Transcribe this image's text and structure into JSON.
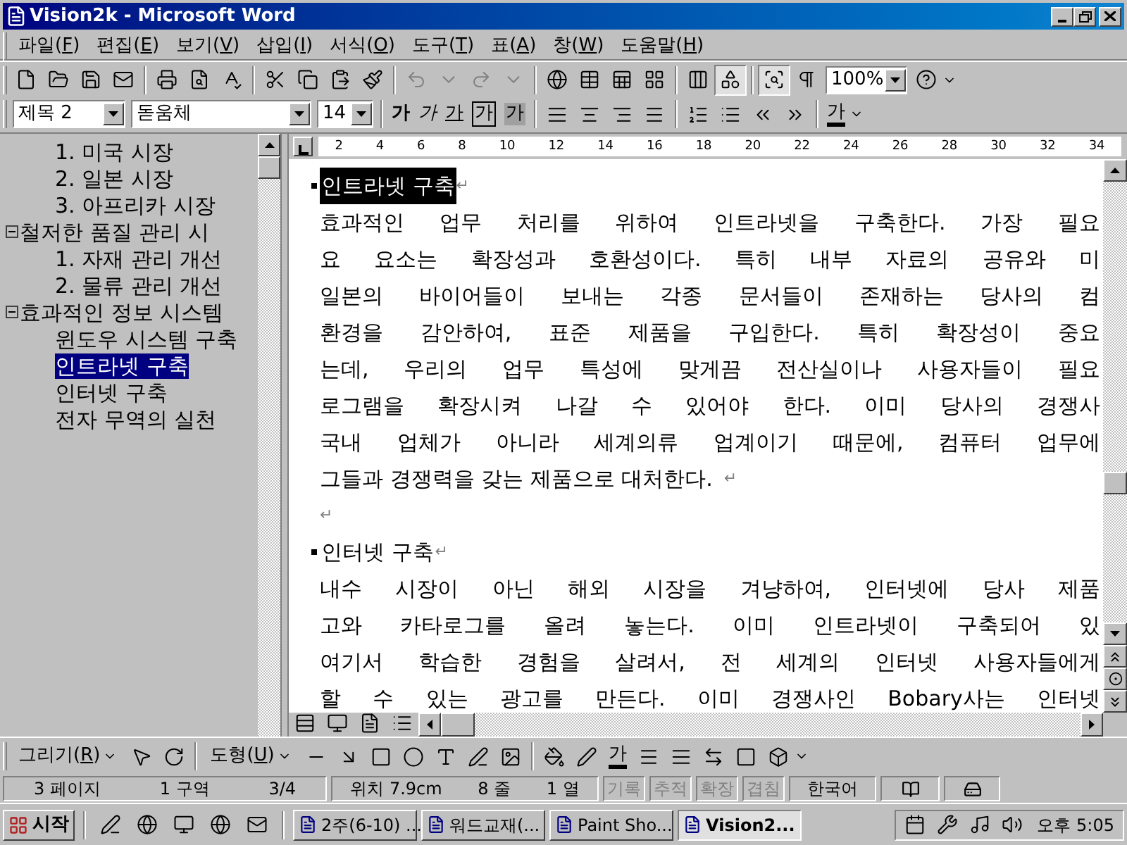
{
  "window": {
    "title": "Vision2k - Microsoft Word"
  },
  "menu": [
    "파일(F)",
    "편집(E)",
    "보기(V)",
    "삽입(I)",
    "서식(O)",
    "도구(T)",
    "표(A)",
    "창(W)",
    "도움말(H)"
  ],
  "standard_toolbar": {
    "drawing_pressed": true,
    "document_map_pressed": true,
    "zoom": "100%"
  },
  "formatting_toolbar": {
    "style": "제목 2",
    "font": "돋움체",
    "size": "14",
    "char_buttons": [
      {
        "kind": "bold",
        "label": "가"
      },
      {
        "kind": "italic",
        "label": "가"
      },
      {
        "kind": "underline",
        "label": "가"
      },
      {
        "kind": "border",
        "label": "가"
      },
      {
        "kind": "shading",
        "label": "가"
      }
    ],
    "font_color": "가"
  },
  "document_map": {
    "continued_children": [
      {
        "text": "1. 미국 시장",
        "selected": false
      },
      {
        "text": "2. 일본 시장",
        "selected": false
      },
      {
        "text": "3. 아프리카 시장",
        "selected": false
      }
    ],
    "items": [
      {
        "text": "철저한 품질 관리 시",
        "expanded": true,
        "children": [
          {
            "text": "1. 자재 관리 개선",
            "selected": false
          },
          {
            "text": "2. 물류 관리 개선",
            "selected": false
          }
        ]
      },
      {
        "text": "효과적인 정보 시스템",
        "expanded": true,
        "children": [
          {
            "text": "윈도우 시스템 구축",
            "selected": false
          },
          {
            "text": "인트라넷 구축",
            "selected": true
          },
          {
            "text": "인터넷 구축",
            "selected": false
          },
          {
            "text": "전자 무역의 실천",
            "selected": false
          }
        ]
      }
    ]
  },
  "ruler": {
    "labels": [
      "2",
      "4",
      "6",
      "8",
      "10",
      "12",
      "14",
      "16",
      "18",
      "20",
      "22",
      "24",
      "26",
      "28",
      "30",
      "32",
      "34"
    ]
  },
  "document": {
    "blocks": [
      {
        "kind": "heading",
        "text": "인트라넷 구축",
        "selected": true,
        "mark": "↵"
      },
      {
        "kind": "body",
        "lines": [
          "효과적인 업무 처리를 위하여 인트라넷을 구축한다. 가장 필요",
          "요 요소는 확장성과 호환성이다. 특히 내부 자료의 공유와 미",
          "일본의 바이어들이 보내는 각종 문서들이 존재하는 당사의 컴",
          "환경을 감안하여, 표준 제품을 구입한다. 특히 확장성이 중요",
          "는데, 우리의 업무 특성에 맞게끔 전산실이나 사용자들이 필요",
          "로그램을 확장시켜 나갈 수 있어야 한다. 이미 당사의 경쟁사",
          "국내 업체가 아니라 세계의류 업계이기 때문에, 컴퓨터 업무에",
          "그들과 경쟁력을 갖는 제품으로 대처한다."
        ],
        "mark": "↵"
      },
      {
        "kind": "empty",
        "mark": "↵"
      },
      {
        "kind": "heading",
        "text": "인터넷 구축",
        "selected": false,
        "mark": "↵"
      },
      {
        "kind": "body",
        "lines": [
          "내수 시장이 아닌 해외 시장을 겨냥하여, 인터넷에 당사 제품",
          "고와 카타로그를 올려 놓는다. 이미 인트라넷이 구축되어 있",
          "여기서 학습한 경험을 살려서, 전 세계의 인터넷 사용자들에게",
          "할 수 있는 광고를 만든다. 이미 경쟁사인 Bobary사는 인터넷"
        ]
      }
    ]
  },
  "drawing_toolbar": {
    "draw_menu": "그리기(R)",
    "autoshapes_menu": "도형(U)",
    "font_color": "가"
  },
  "status_bar": {
    "panels": [
      [
        "3 페이지",
        "1 구역",
        "3/4"
      ],
      [
        "위치 7.9cm",
        "8 줄",
        "1 열"
      ]
    ],
    "modes": [
      {
        "text": "기록",
        "disabled": true
      },
      {
        "text": "추적",
        "disabled": true
      },
      {
        "text": "확장",
        "disabled": true
      },
      {
        "text": "겹침",
        "disabled": true
      }
    ],
    "language": "한국어"
  },
  "taskbar": {
    "start": "시작",
    "tasks": [
      {
        "label": "2주(6-10) ...",
        "selected": false
      },
      {
        "label": "워드교재(...",
        "selected": false
      },
      {
        "label": "Paint Sho...",
        "selected": false
      },
      {
        "label": "Vision2...",
        "selected": true
      }
    ],
    "clock": "오후 5:05"
  }
}
